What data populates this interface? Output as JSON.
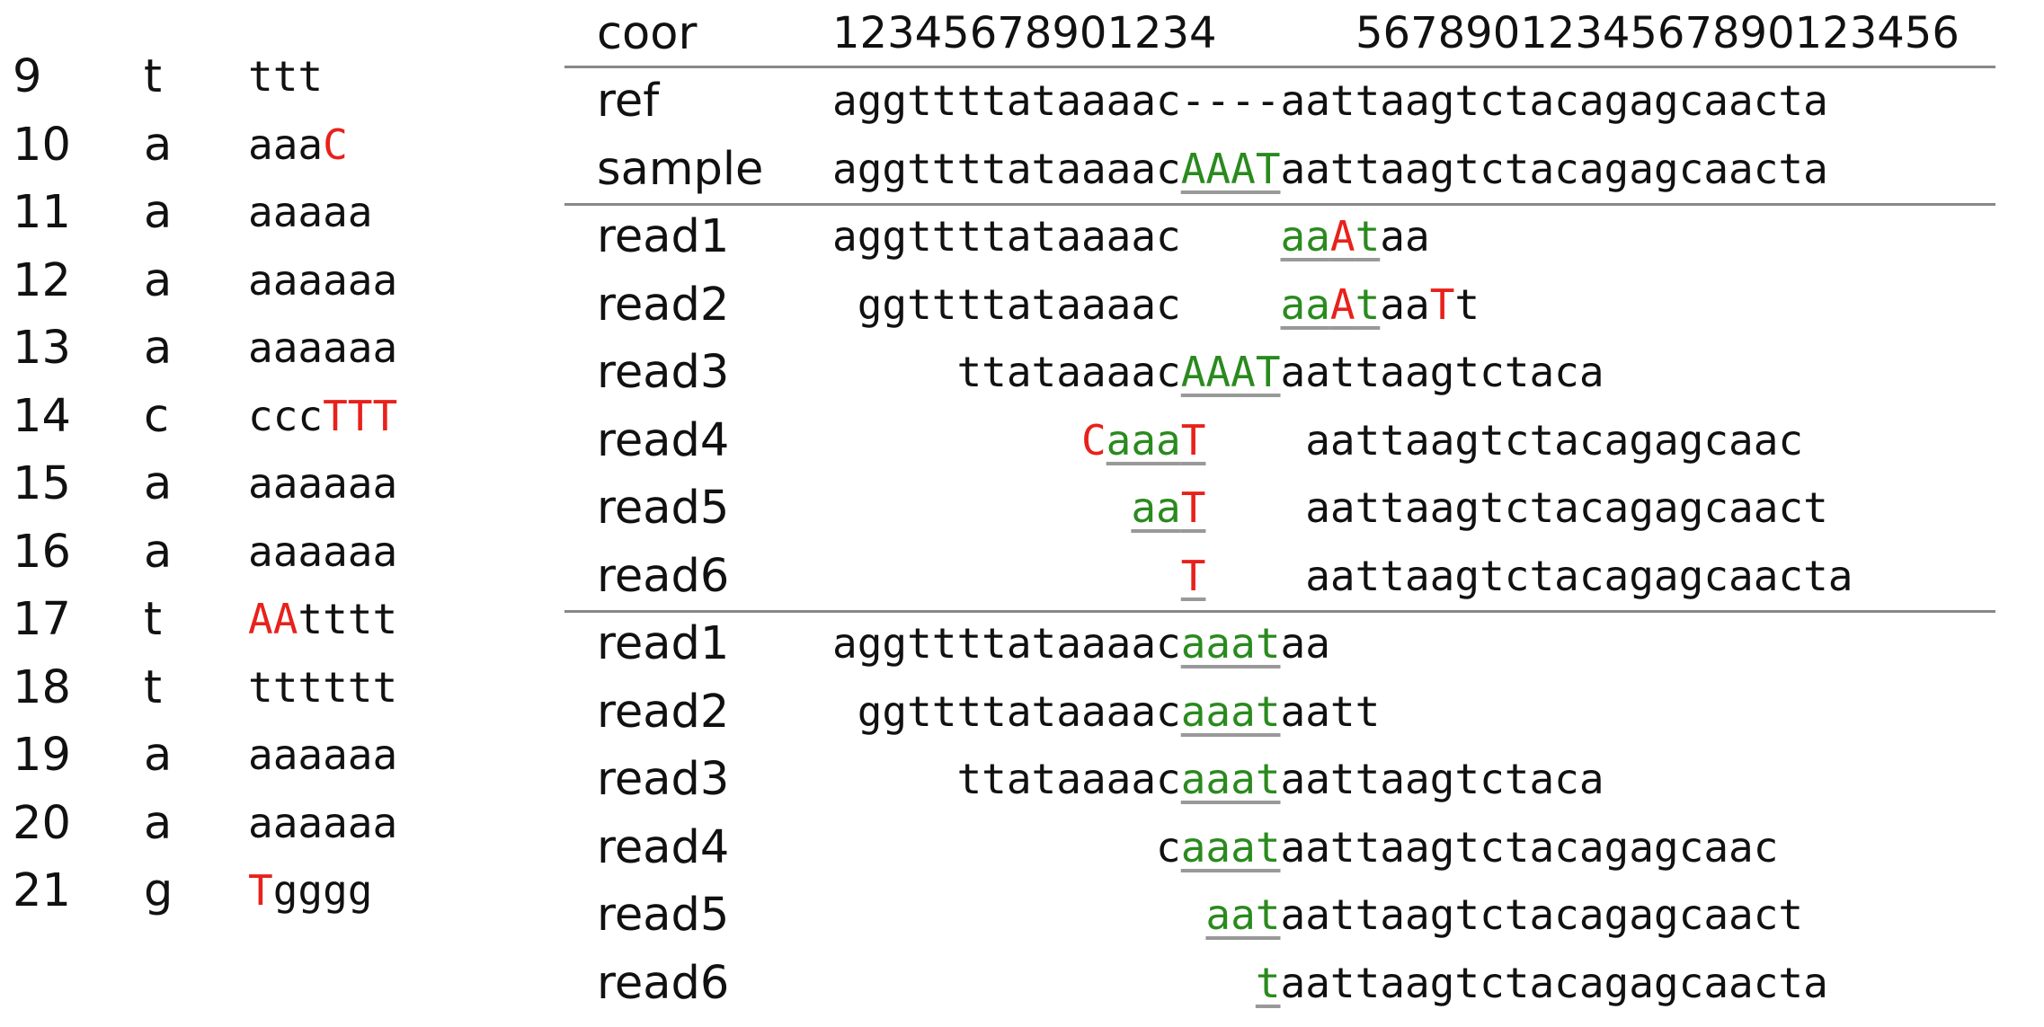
{
  "header": {
    "label": "coor",
    "coor_a": "12345678901234",
    "coor_b": "5678901234567890123456"
  },
  "pileup_rows": [
    {
      "pos": "9",
      "ref": "t",
      "pile": [
        {
          "t": "ttt",
          "c": "n"
        }
      ]
    },
    {
      "pos": "10",
      "ref": "a",
      "pile": [
        {
          "t": "aaa",
          "c": "n"
        },
        {
          "t": "C",
          "c": "r"
        }
      ]
    },
    {
      "pos": "11",
      "ref": "a",
      "pile": [
        {
          "t": "aaaaa",
          "c": "n"
        }
      ]
    },
    {
      "pos": "12",
      "ref": "a",
      "pile": [
        {
          "t": "aaaaaa",
          "c": "n"
        }
      ]
    },
    {
      "pos": "13",
      "ref": "a",
      "pile": [
        {
          "t": "aaaaaa",
          "c": "n"
        }
      ]
    },
    {
      "pos": "14",
      "ref": "c",
      "pile": [
        {
          "t": "ccc",
          "c": "n"
        },
        {
          "t": "TTT",
          "c": "r"
        }
      ]
    },
    {
      "pos": "15",
      "ref": "a",
      "pile": [
        {
          "t": "aaaaaa",
          "c": "n"
        }
      ]
    },
    {
      "pos": "16",
      "ref": "a",
      "pile": [
        {
          "t": "aaaaaa",
          "c": "n"
        }
      ]
    },
    {
      "pos": "17",
      "ref": "t",
      "pile": [
        {
          "t": "AA",
          "c": "r"
        },
        {
          "t": "tttt",
          "c": "n"
        }
      ]
    },
    {
      "pos": "18",
      "ref": "t",
      "pile": [
        {
          "t": "tttttt",
          "c": "n"
        }
      ]
    },
    {
      "pos": "19",
      "ref": "a",
      "pile": [
        {
          "t": "aaaaaa",
          "c": "n"
        }
      ]
    },
    {
      "pos": "20",
      "ref": "a",
      "pile": [
        {
          "t": "aaaaaa",
          "c": "n"
        }
      ]
    },
    {
      "pos": "21",
      "ref": "g",
      "pile": [
        {
          "t": "T",
          "c": "r"
        },
        {
          "t": "gggg",
          "c": "n"
        }
      ]
    }
  ],
  "alignment_rows": [
    {
      "label": "ref",
      "segs": [
        {
          "t": "aggttttataaaac----aattaagtctacagagcaacta",
          "c": "n"
        }
      ]
    },
    {
      "label": "sample",
      "segs": [
        {
          "t": "aggttttataaaac",
          "c": "n"
        },
        {
          "t": "AAAT",
          "c": "g",
          "u": true
        },
        {
          "t": "aattaagtctacagagcaacta",
          "c": "n"
        }
      ]
    },
    {
      "label": "read1",
      "segs": [
        {
          "t": "aggttttataaaac    ",
          "c": "n"
        },
        {
          "t": "aa",
          "c": "g",
          "u": true
        },
        {
          "t": "A",
          "c": "r",
          "u": true
        },
        {
          "t": "t",
          "c": "g",
          "u": true
        },
        {
          "t": "aa",
          "c": "n"
        }
      ]
    },
    {
      "label": "read2",
      "segs": [
        {
          "t": " ggttttataaaac    ",
          "c": "n"
        },
        {
          "t": "aa",
          "c": "g",
          "u": true
        },
        {
          "t": "A",
          "c": "r",
          "u": true
        },
        {
          "t": "t",
          "c": "g",
          "u": true
        },
        {
          "t": "aa",
          "c": "n"
        },
        {
          "t": "T",
          "c": "r"
        },
        {
          "t": "t",
          "c": "n"
        }
      ]
    },
    {
      "label": "read3",
      "segs": [
        {
          "t": "     ttataaaac",
          "c": "n"
        },
        {
          "t": "AAAT",
          "c": "g",
          "u": true
        },
        {
          "t": "aattaagtctaca",
          "c": "n"
        }
      ]
    },
    {
      "label": "read4",
      "segs": [
        {
          "t": "          ",
          "c": "n"
        },
        {
          "t": "C",
          "c": "r"
        },
        {
          "t": "aaa",
          "c": "g",
          "u": true
        },
        {
          "t": "T",
          "c": "r",
          "u": true
        },
        {
          "t": "    aattaagtctacagagcaac",
          "c": "n"
        }
      ]
    },
    {
      "label": "read5",
      "segs": [
        {
          "t": "            ",
          "c": "n"
        },
        {
          "t": "aa",
          "c": "g",
          "u": true
        },
        {
          "t": "T",
          "c": "r",
          "u": true
        },
        {
          "t": "    aattaagtctacagagcaact",
          "c": "n"
        }
      ]
    },
    {
      "label": "read6",
      "segs": [
        {
          "t": "              ",
          "c": "n"
        },
        {
          "t": "T",
          "c": "r",
          "u": true
        },
        {
          "t": "    aattaagtctacagagcaacta",
          "c": "n"
        }
      ]
    },
    {
      "label": "read1",
      "segs": [
        {
          "t": "aggttttataaaac",
          "c": "n"
        },
        {
          "t": "aaat",
          "c": "g",
          "u": true
        },
        {
          "t": "aa",
          "c": "n"
        }
      ]
    },
    {
      "label": "read2",
      "segs": [
        {
          "t": " ggttttataaaac",
          "c": "n"
        },
        {
          "t": "aaat",
          "c": "g",
          "u": true
        },
        {
          "t": "aatt",
          "c": "n"
        }
      ]
    },
    {
      "label": "read3",
      "segs": [
        {
          "t": "     ttataaaac",
          "c": "n"
        },
        {
          "t": "aaat",
          "c": "g",
          "u": true
        },
        {
          "t": "aattaagtctaca",
          "c": "n"
        }
      ]
    },
    {
      "label": "read4",
      "segs": [
        {
          "t": "             c",
          "c": "n"
        },
        {
          "t": "aaat",
          "c": "g",
          "u": true
        },
        {
          "t": "aattaagtctacagagcaac",
          "c": "n"
        }
      ]
    },
    {
      "label": "read5",
      "segs": [
        {
          "t": "               ",
          "c": "n"
        },
        {
          "t": "aat",
          "c": "g",
          "u": true
        },
        {
          "t": "aattaagtctacagagcaact",
          "c": "n"
        }
      ]
    },
    {
      "label": "read6",
      "segs": [
        {
          "t": "                 ",
          "c": "n"
        },
        {
          "t": "t",
          "c": "g",
          "u": true
        },
        {
          "t": "aattaagtctacagagcaacta",
          "c": "n"
        }
      ]
    }
  ],
  "colors": {
    "mismatch": "#e8211b",
    "insertion": "#2a8a1e",
    "rule": "#888888"
  }
}
